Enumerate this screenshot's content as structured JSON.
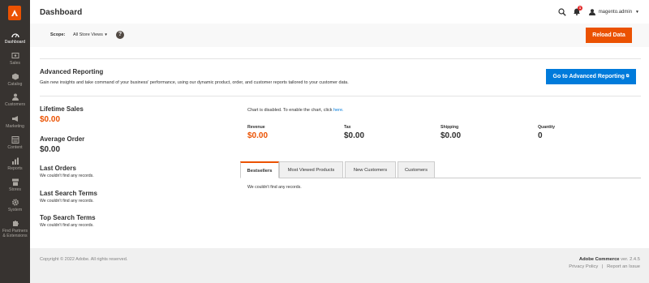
{
  "header": {
    "title": "Dashboard",
    "notifications_count": "1",
    "user": "magento.admin"
  },
  "sidebar": {
    "items": [
      {
        "label": "Dashboard",
        "icon": "dashboard-icon"
      },
      {
        "label": "Sales",
        "icon": "dollar-icon"
      },
      {
        "label": "Catalog",
        "icon": "cube-icon"
      },
      {
        "label": "Customers",
        "icon": "customers-icon"
      },
      {
        "label": "Marketing",
        "icon": "megaphone-icon"
      },
      {
        "label": "Content",
        "icon": "layout-icon"
      },
      {
        "label": "Reports",
        "icon": "bar-chart-icon"
      },
      {
        "label": "Stores",
        "icon": "store-icon"
      },
      {
        "label": "System",
        "icon": "gear-icon"
      },
      {
        "label": "Find Partners",
        "label2": "& Extensions",
        "icon": "puzzle-icon"
      }
    ]
  },
  "scope": {
    "label": "Scope:",
    "value": "All Store Views",
    "reload_label": "Reload Data"
  },
  "advanced": {
    "title": "Advanced Reporting",
    "description": "Gain new insights and take command of your business' performance, using our dynamic product, order, and customer reports tailored to your customer data.",
    "button_label": "Go to Advanced Reporting"
  },
  "stats": {
    "lifetime_sales_label": "Lifetime Sales",
    "lifetime_sales_value": "$0.00",
    "average_order_label": "Average Order",
    "average_order_value": "$0.00",
    "last_orders_label": "Last Orders",
    "last_orders_empty": "We couldn't find any records.",
    "last_search_label": "Last Search Terms",
    "last_search_empty": "We couldn't find any records.",
    "top_search_label": "Top Search Terms",
    "top_search_empty": "We couldn't find any records."
  },
  "chart": {
    "note": "Chart is disabled. To enable the chart, click",
    "link": "here."
  },
  "totals": [
    {
      "label": "Revenue",
      "value": "$0.00"
    },
    {
      "label": "Tax",
      "value": "$0.00"
    },
    {
      "label": "Shipping",
      "value": "$0.00"
    },
    {
      "label": "Quantity",
      "value": "0"
    }
  ],
  "tabs": {
    "items": [
      "Bestsellers",
      "Most Viewed Products",
      "New Customers",
      "Customers"
    ],
    "content": "We couldn't find any records."
  },
  "footer": {
    "copyright": "Copyright © 2022 Adobe. All rights reserved.",
    "product": "Adobe Commerce",
    "version": " ver. 2.4.5",
    "privacy": "Privacy Policy",
    "separator": "|",
    "report": "Report an Issue"
  },
  "colors": {
    "accent": "#eb5202",
    "link": "#007bdb",
    "sidebar": "#373330"
  }
}
